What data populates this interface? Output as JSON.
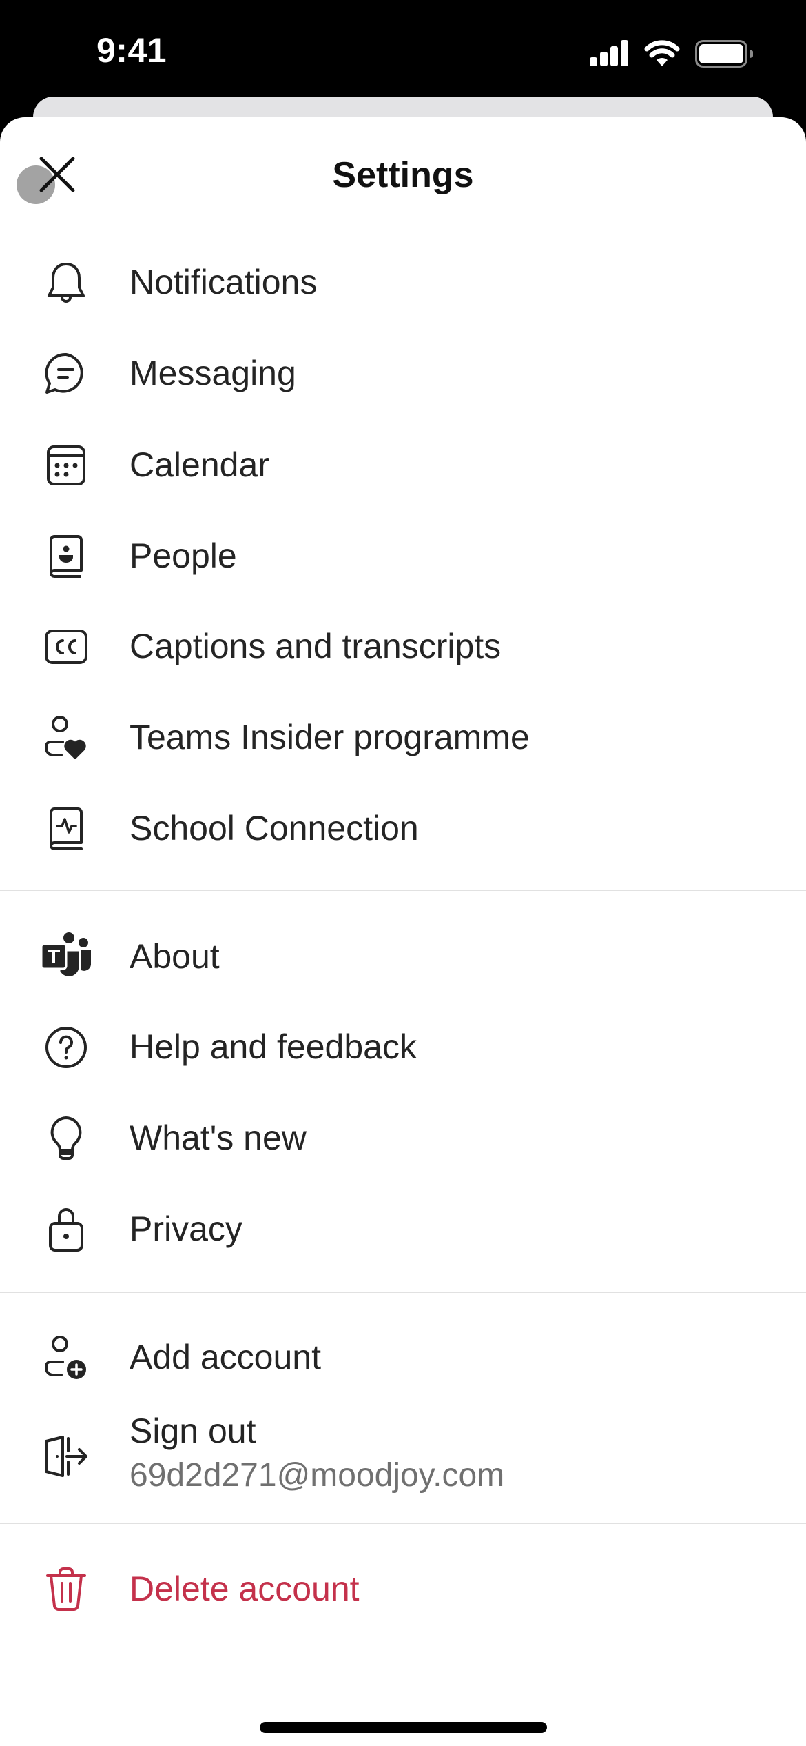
{
  "status_bar": {
    "time": "9:41",
    "icons": [
      "cellular-signal-icon",
      "wifi-icon",
      "battery-icon"
    ]
  },
  "header": {
    "title": "Settings",
    "close_icon": "close-icon"
  },
  "sections": [
    {
      "items": [
        {
          "id": "notifications",
          "label": "Notifications",
          "icon": "bell-icon"
        },
        {
          "id": "messaging",
          "label": "Messaging",
          "icon": "chat-bubble-icon"
        },
        {
          "id": "calendar",
          "label": "Calendar",
          "icon": "calendar-icon"
        },
        {
          "id": "people",
          "label": "People",
          "icon": "contact-book-icon"
        },
        {
          "id": "captions",
          "label": "Captions and transcripts",
          "icon": "closed-captions-icon"
        },
        {
          "id": "insider",
          "label": "Teams Insider programme",
          "icon": "person-heart-icon"
        },
        {
          "id": "school-connection",
          "label": "School Connection",
          "icon": "book-pulse-icon"
        }
      ]
    },
    {
      "items": [
        {
          "id": "about",
          "label": "About",
          "icon": "teams-logo-icon"
        },
        {
          "id": "help",
          "label": "Help and feedback",
          "icon": "question-circle-icon"
        },
        {
          "id": "whats-new",
          "label": "What's new",
          "icon": "lightbulb-icon"
        },
        {
          "id": "privacy",
          "label": "Privacy",
          "icon": "lock-icon"
        }
      ]
    },
    {
      "items": [
        {
          "id": "add-account",
          "label": "Add account",
          "icon": "person-add-icon"
        },
        {
          "id": "sign-out",
          "label": "Sign out",
          "sublabel": "69d2d271@moodjoy.com",
          "icon": "sign-out-door-icon"
        }
      ]
    },
    {
      "items": [
        {
          "id": "delete-account",
          "label": "Delete account",
          "icon": "trash-icon",
          "color": "#c4314b"
        }
      ]
    }
  ],
  "colors": {
    "danger": "#c4314b",
    "text": "#242424",
    "secondary_text": "#707070"
  }
}
